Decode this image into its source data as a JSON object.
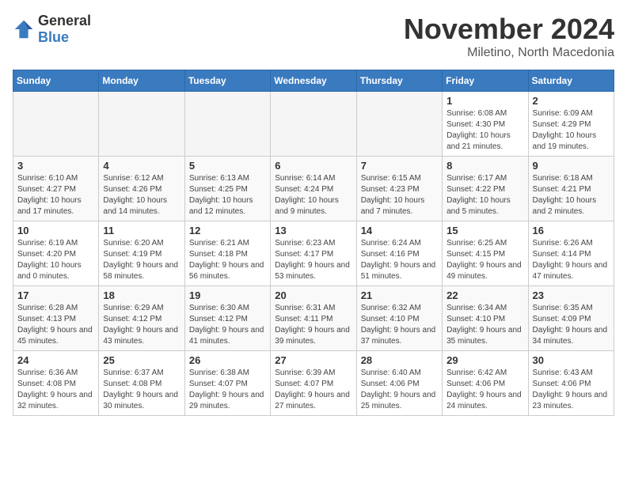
{
  "header": {
    "logo_general": "General",
    "logo_blue": "Blue",
    "month_title": "November 2024",
    "location": "Miletino, North Macedonia"
  },
  "days_of_week": [
    "Sunday",
    "Monday",
    "Tuesday",
    "Wednesday",
    "Thursday",
    "Friday",
    "Saturday"
  ],
  "weeks": [
    [
      {
        "day": "",
        "info": ""
      },
      {
        "day": "",
        "info": ""
      },
      {
        "day": "",
        "info": ""
      },
      {
        "day": "",
        "info": ""
      },
      {
        "day": "",
        "info": ""
      },
      {
        "day": "1",
        "info": "Sunrise: 6:08 AM\nSunset: 4:30 PM\nDaylight: 10 hours and 21 minutes."
      },
      {
        "day": "2",
        "info": "Sunrise: 6:09 AM\nSunset: 4:29 PM\nDaylight: 10 hours and 19 minutes."
      }
    ],
    [
      {
        "day": "3",
        "info": "Sunrise: 6:10 AM\nSunset: 4:27 PM\nDaylight: 10 hours and 17 minutes."
      },
      {
        "day": "4",
        "info": "Sunrise: 6:12 AM\nSunset: 4:26 PM\nDaylight: 10 hours and 14 minutes."
      },
      {
        "day": "5",
        "info": "Sunrise: 6:13 AM\nSunset: 4:25 PM\nDaylight: 10 hours and 12 minutes."
      },
      {
        "day": "6",
        "info": "Sunrise: 6:14 AM\nSunset: 4:24 PM\nDaylight: 10 hours and 9 minutes."
      },
      {
        "day": "7",
        "info": "Sunrise: 6:15 AM\nSunset: 4:23 PM\nDaylight: 10 hours and 7 minutes."
      },
      {
        "day": "8",
        "info": "Sunrise: 6:17 AM\nSunset: 4:22 PM\nDaylight: 10 hours and 5 minutes."
      },
      {
        "day": "9",
        "info": "Sunrise: 6:18 AM\nSunset: 4:21 PM\nDaylight: 10 hours and 2 minutes."
      }
    ],
    [
      {
        "day": "10",
        "info": "Sunrise: 6:19 AM\nSunset: 4:20 PM\nDaylight: 10 hours and 0 minutes."
      },
      {
        "day": "11",
        "info": "Sunrise: 6:20 AM\nSunset: 4:19 PM\nDaylight: 9 hours and 58 minutes."
      },
      {
        "day": "12",
        "info": "Sunrise: 6:21 AM\nSunset: 4:18 PM\nDaylight: 9 hours and 56 minutes."
      },
      {
        "day": "13",
        "info": "Sunrise: 6:23 AM\nSunset: 4:17 PM\nDaylight: 9 hours and 53 minutes."
      },
      {
        "day": "14",
        "info": "Sunrise: 6:24 AM\nSunset: 4:16 PM\nDaylight: 9 hours and 51 minutes."
      },
      {
        "day": "15",
        "info": "Sunrise: 6:25 AM\nSunset: 4:15 PM\nDaylight: 9 hours and 49 minutes."
      },
      {
        "day": "16",
        "info": "Sunrise: 6:26 AM\nSunset: 4:14 PM\nDaylight: 9 hours and 47 minutes."
      }
    ],
    [
      {
        "day": "17",
        "info": "Sunrise: 6:28 AM\nSunset: 4:13 PM\nDaylight: 9 hours and 45 minutes."
      },
      {
        "day": "18",
        "info": "Sunrise: 6:29 AM\nSunset: 4:12 PM\nDaylight: 9 hours and 43 minutes."
      },
      {
        "day": "19",
        "info": "Sunrise: 6:30 AM\nSunset: 4:12 PM\nDaylight: 9 hours and 41 minutes."
      },
      {
        "day": "20",
        "info": "Sunrise: 6:31 AM\nSunset: 4:11 PM\nDaylight: 9 hours and 39 minutes."
      },
      {
        "day": "21",
        "info": "Sunrise: 6:32 AM\nSunset: 4:10 PM\nDaylight: 9 hours and 37 minutes."
      },
      {
        "day": "22",
        "info": "Sunrise: 6:34 AM\nSunset: 4:10 PM\nDaylight: 9 hours and 35 minutes."
      },
      {
        "day": "23",
        "info": "Sunrise: 6:35 AM\nSunset: 4:09 PM\nDaylight: 9 hours and 34 minutes."
      }
    ],
    [
      {
        "day": "24",
        "info": "Sunrise: 6:36 AM\nSunset: 4:08 PM\nDaylight: 9 hours and 32 minutes."
      },
      {
        "day": "25",
        "info": "Sunrise: 6:37 AM\nSunset: 4:08 PM\nDaylight: 9 hours and 30 minutes."
      },
      {
        "day": "26",
        "info": "Sunrise: 6:38 AM\nSunset: 4:07 PM\nDaylight: 9 hours and 29 minutes."
      },
      {
        "day": "27",
        "info": "Sunrise: 6:39 AM\nSunset: 4:07 PM\nDaylight: 9 hours and 27 minutes."
      },
      {
        "day": "28",
        "info": "Sunrise: 6:40 AM\nSunset: 4:06 PM\nDaylight: 9 hours and 25 minutes."
      },
      {
        "day": "29",
        "info": "Sunrise: 6:42 AM\nSunset: 4:06 PM\nDaylight: 9 hours and 24 minutes."
      },
      {
        "day": "30",
        "info": "Sunrise: 6:43 AM\nSunset: 4:06 PM\nDaylight: 9 hours and 23 minutes."
      }
    ]
  ]
}
